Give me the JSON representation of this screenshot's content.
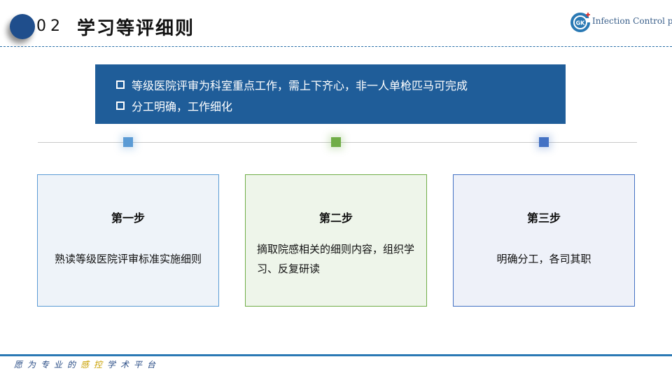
{
  "header": {
    "number": "02",
    "title": "学习等评细则"
  },
  "logo": {
    "mark_text": "GK",
    "text": "Infection Control plus"
  },
  "banner": {
    "items": [
      "等级医院评审为科室重点工作，需上下齐心，非一人单枪匹马可完成",
      "分工明确，工作细化"
    ]
  },
  "steps": [
    {
      "title": "第一步",
      "body": "熟读等级医院评审标准实施细则"
    },
    {
      "title": "第二步",
      "body": "摘取院感相关的细则内容，组织学习、反复研读"
    },
    {
      "title": "第三步",
      "body": "明确分工，各司其职"
    }
  ],
  "footer": {
    "part1": "愿为专业的",
    "highlight": "感控",
    "part2": "学术平台"
  },
  "colors": {
    "primary": "#1f5d99",
    "step1": "#5b9bd5",
    "step2": "#70ad47",
    "step3": "#4472c4",
    "footer_highlight": "#c9a000"
  }
}
